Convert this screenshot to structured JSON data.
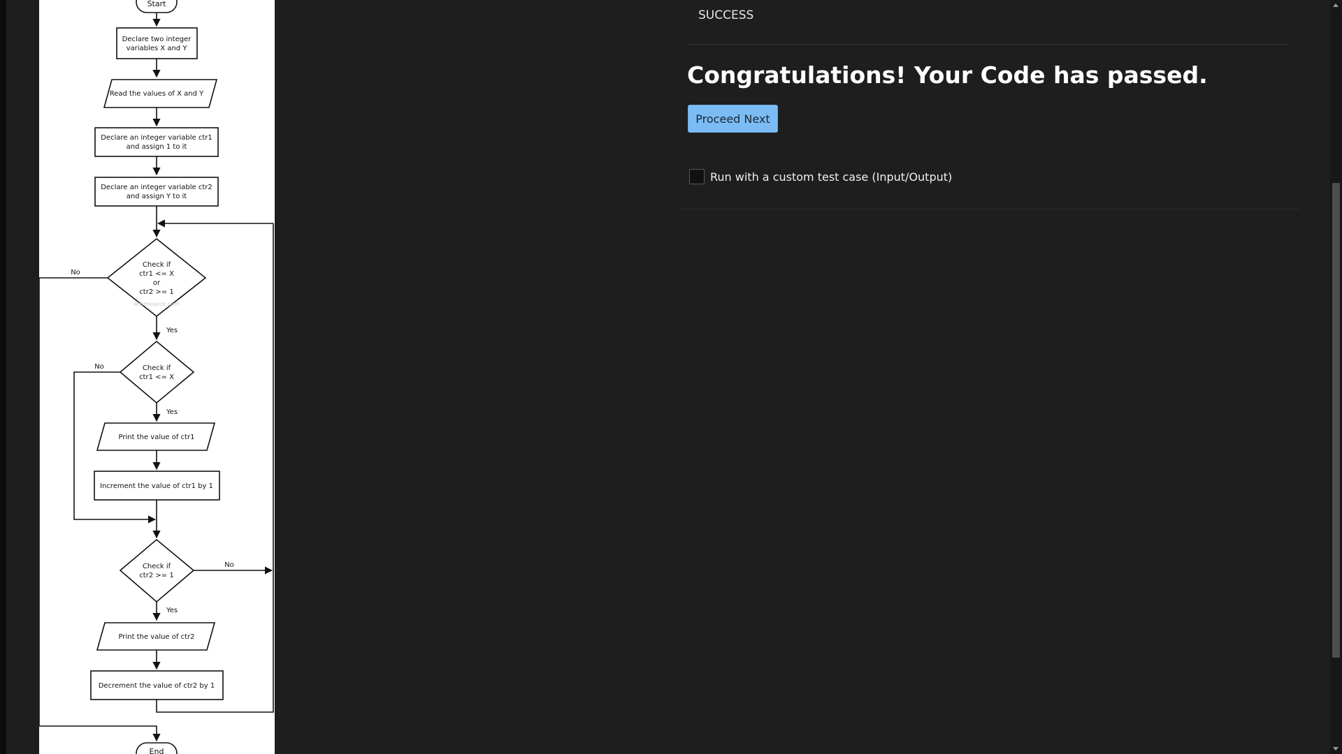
{
  "flowchart": {
    "start": "Start",
    "declare_xy": [
      "Declare two integer",
      "variables X and Y"
    ],
    "read_xy": "Read the values of X and Y",
    "declare_ctr1": [
      "Declare an integer variable ctr1",
      "and assign 1 to it"
    ],
    "declare_ctr2": [
      "Declare an integer variable ctr2",
      "and assign Y to it"
    ],
    "check_loop": [
      "Check if",
      "ctr1 <= X",
      "or",
      "ctr2 >= 1"
    ],
    "watermark": "w3resource.com",
    "check_ctr1": [
      "Check if",
      "ctr1 <= X"
    ],
    "print_ctr1": "Print the value of ctr1",
    "increment_ctr1": "Increment the value of ctr1 by 1",
    "check_ctr2": [
      "Check if",
      "ctr2 >= 1"
    ],
    "print_ctr2": "Print the value of ctr2",
    "decrement_ctr2": "Decrement the value of ctr2 by 1",
    "end": "End",
    "yes": "Yes",
    "no": "No"
  },
  "result": {
    "status": "SUCCESS",
    "headline": "Congratulations! Your Code has passed.",
    "proceed_label": "Proceed Next",
    "custom_test_label": "Run with a custom test case (Input/Output)",
    "custom_test_checked": false
  },
  "colors": {
    "background": "#1e1e1e",
    "button": "#7bbcf4",
    "panel": "#ffffff"
  }
}
